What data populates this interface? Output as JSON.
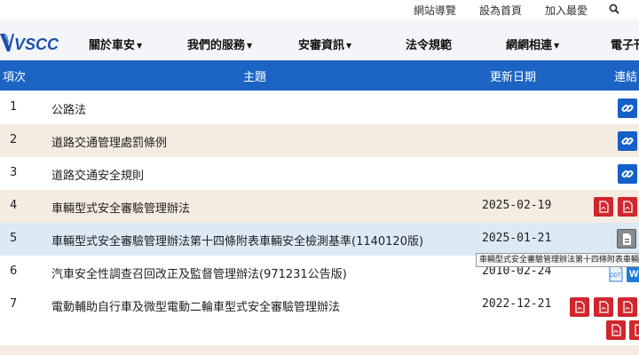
{
  "top_links": [
    "網站導覽",
    "設為首頁",
    "加入最愛"
  ],
  "logo_text": "VSCC",
  "nav": [
    "關於車安",
    "我們的服務",
    "安審資訊",
    "法令規範",
    "網網相連",
    "電子刊"
  ],
  "table": {
    "headers": [
      "項次",
      "主題",
      "更新日期",
      "連結"
    ],
    "rows": [
      {
        "idx": "1",
        "title": "公路法",
        "date": ""
      },
      {
        "idx": "2",
        "title": "道路交通管理處罰條例",
        "date": ""
      },
      {
        "idx": "3",
        "title": "道路交通安全規則",
        "date": ""
      },
      {
        "idx": "4",
        "title": "車輛型式安全審驗管理辦法",
        "date": "2025-02-19"
      },
      {
        "idx": "5",
        "title": "車輛型式安全審驗管理辦法第十四條附表車輛安全檢測基準(1140120版)",
        "date": "2025-01-21"
      },
      {
        "idx": "6",
        "title": "汽車安全性調查召回改正及監督管理辦法(971231公告版)",
        "date": "2010-02-24"
      },
      {
        "idx": "7",
        "title": "電動輔助自行車及微型電動二輪車型式安全審驗管理辦法",
        "date": "2022-12-21"
      }
    ]
  },
  "tooltip": "車輛型式安全審驗管理辦法第十四條附表車輛安全檢測基準",
  "icon_labels": {
    "odt": "ODT",
    "word": "W"
  },
  "colors": {
    "header_blue": "#1b64c4",
    "row_beige": "#f4ece1",
    "row_highlight": "#dceaf6",
    "pdf_red": "#d0262e",
    "link_blue": "#1560c8"
  }
}
